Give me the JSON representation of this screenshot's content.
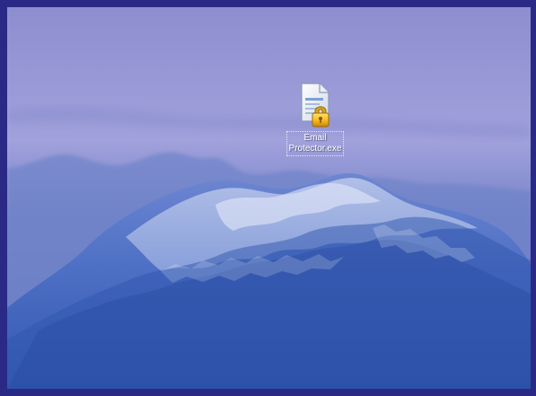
{
  "desktop": {
    "wallpaper": "mountain-sky",
    "icons": [
      {
        "label_line1": "Email",
        "label_line2": "Protector.exe",
        "icon": "document-lock-icon"
      }
    ]
  },
  "colors": {
    "frame": "#2a2a86",
    "sky": "#9a9ad8",
    "mountain": "#3f5fb4",
    "snow": "#d7def4",
    "icon_label_text": "#ffffff"
  }
}
